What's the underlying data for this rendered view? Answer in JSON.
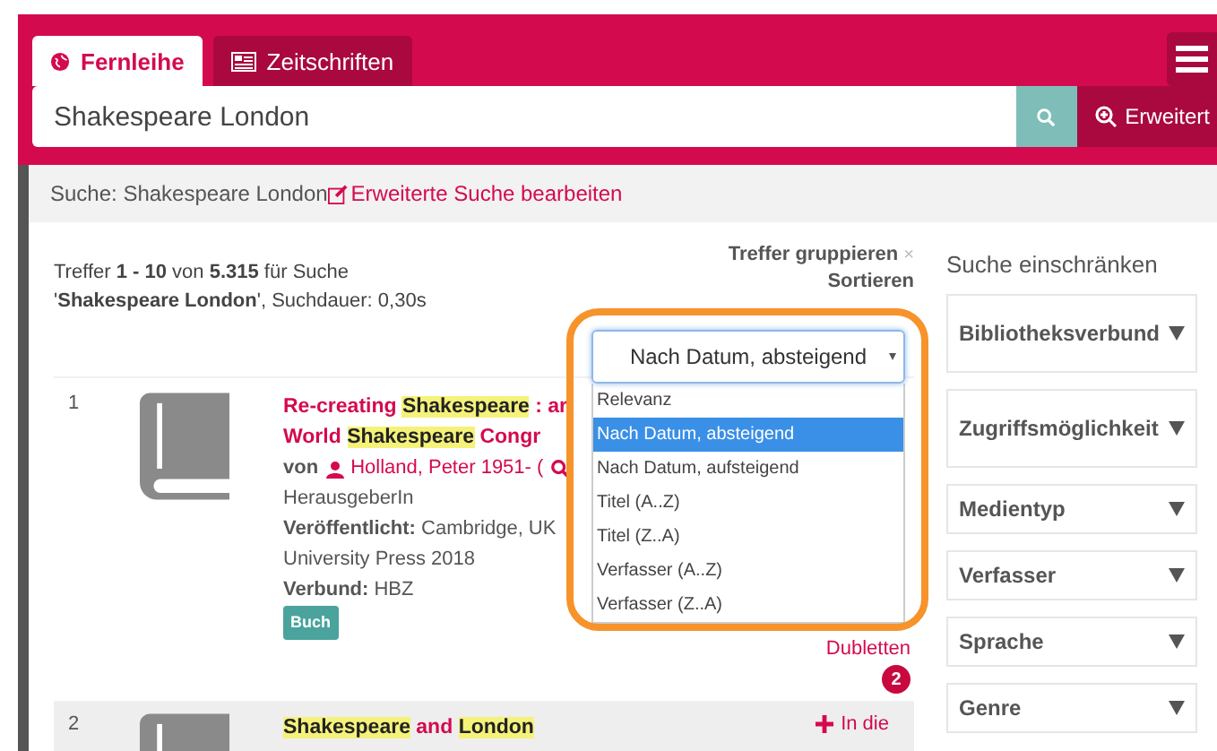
{
  "tabs": [
    {
      "label": "Fernleihe",
      "selected": true
    },
    {
      "label": "Zeitschriften",
      "selected": false
    }
  ],
  "search": {
    "value": "Shakespeare London",
    "advanced_button": "Erweitert"
  },
  "breadcrumb": {
    "label": "Suche: Shakespeare London",
    "link": "Erweiterte Suche bearbeiten"
  },
  "summary": "Treffer **1 - 10** von **5.315** für Suche '**Shakespeare London**', Suchdauer: 0,30s",
  "grouping": {
    "label": "Treffer gruppieren",
    "close": "×"
  },
  "sort": {
    "label": "Sortieren",
    "value": "Nach Datum, absteigend",
    "expanded": true,
    "options": [
      {
        "label": "Relevanz",
        "selected": false
      },
      {
        "label": "Nach Datum, absteigend",
        "selected": true
      },
      {
        "label": "Nach Datum, aufsteigend",
        "selected": false
      },
      {
        "label": "Titel (A..Z)",
        "selected": false
      },
      {
        "label": "Titel (Z..A)",
        "selected": false
      },
      {
        "label": "Verfasser (A..Z)",
        "selected": false
      },
      {
        "label": "Verfasser (Z..A)",
        "selected": false
      }
    ]
  },
  "results": [
    {
      "number": "1",
      "shaded": false,
      "title_lines": [
        [
          {
            "text": "Re-creating ",
            "highlight": false
          },
          {
            "text": "Shakespeare",
            "highlight": true
          },
          {
            "text": " : ar",
            "highlight": false
          }
        ],
        [
          {
            "text": "World ",
            "highlight": false
          },
          {
            "text": "Shakespeare",
            "highlight": true
          },
          {
            "text": " Congr",
            "highlight": false
          }
        ]
      ],
      "author_prefix": "von",
      "author": "Holland, Peter 1951- (",
      "role": "HerausgeberIn",
      "fields": [
        {
          "label": "Veröffentlicht:",
          "value": "Cambridge, UK"
        },
        {
          "value": "University Press 2018"
        },
        {
          "label": "Verbund:",
          "value": "HBZ"
        }
      ],
      "format": "Buch",
      "duplicates": "Dubletten",
      "duplicates_count": "2"
    },
    {
      "number": "2",
      "shaded": true,
      "title_lines": [
        [
          {
            "text": "Shakespeare",
            "highlight": true
          },
          {
            "text": " and ",
            "highlight": false
          },
          {
            "text": "London",
            "highlight": true
          }
        ]
      ],
      "action": "In die"
    }
  ],
  "facets": {
    "title": "Suche einschränken",
    "items": [
      "Bibliotheksverbund",
      "Zugriffsmöglichkeit",
      "Medientyp",
      "Verfasser",
      "Sprache",
      "Genre"
    ]
  }
}
